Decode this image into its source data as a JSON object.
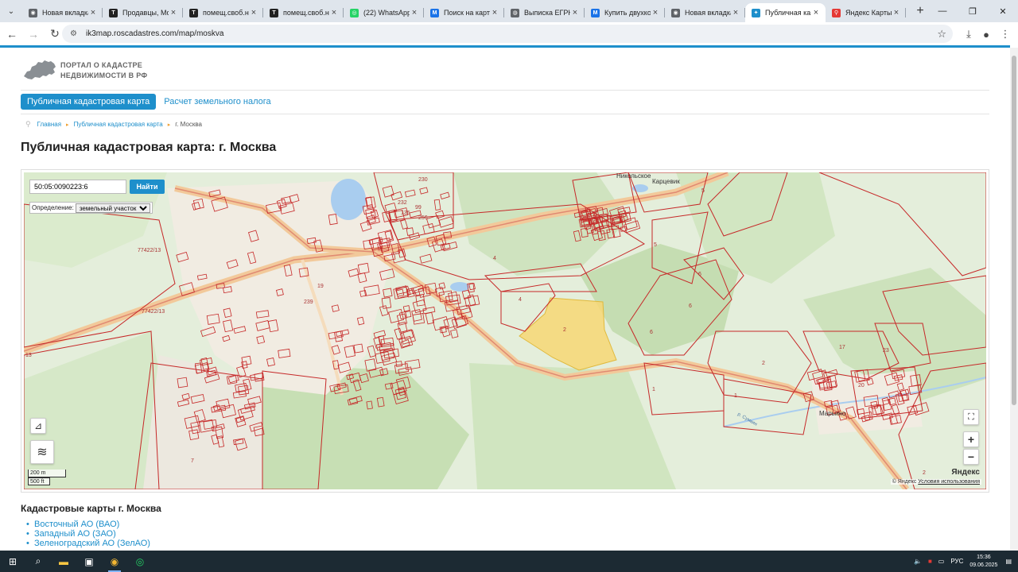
{
  "browser": {
    "tabs": [
      {
        "title": "Новая вкладка",
        "icon": "chrome-icon",
        "color": "#5f6368"
      },
      {
        "title": "Продавцы, Мо",
        "icon": "t-icon",
        "color": "#222222"
      },
      {
        "title": "помещ.своб.н",
        "icon": "t-icon",
        "color": "#222222"
      },
      {
        "title": "помещ.своб.н",
        "icon": "t-icon",
        "color": "#222222"
      },
      {
        "title": "(22) WhatsApp",
        "icon": "whatsapp-icon",
        "color": "#25d366"
      },
      {
        "title": "Поиск на карт",
        "icon": "m-icon",
        "color": "#1a73e8"
      },
      {
        "title": "Выписка ЕГРН",
        "icon": "globe-icon",
        "color": "#5f6368"
      },
      {
        "title": "Купить двухко",
        "icon": "m-icon",
        "color": "#1a73e8"
      },
      {
        "title": "Новая вкладка",
        "icon": "chrome-icon",
        "color": "#5f6368"
      },
      {
        "title": "Публичная ка",
        "icon": "ppk-icon",
        "color": "#1e8fcb",
        "active": true
      },
      {
        "title": "Яндекс Карты",
        "icon": "map-pin-icon",
        "color": "#e53935"
      }
    ],
    "url": "ik3map.roscadastres.com/map/moskva"
  },
  "site": {
    "logo_line1": "ПОРТАЛ О КАДАСТРЕ",
    "logo_line2": "НЕДВИЖИМОСТИ В РФ",
    "menu_active": "Публичная кадастровая карта",
    "menu_link": "Расчет земельного налога",
    "breadcrumbs": [
      "Главная",
      "Публичная кадастровая карта",
      "г. Москва"
    ],
    "page_title": "Публичная кадастровая карта: г. Москва"
  },
  "map": {
    "search_value": "50:05:0090223:6",
    "search_button": "Найти",
    "definition_label": "Определение:",
    "definition_value": "земельный участок",
    "scale_metric": "200 m",
    "scale_imperial": "500 ft",
    "brand": "Яндекс",
    "copyright": "© Яндекс",
    "terms_link": "Условия использования",
    "place_labels": [
      "Марьино",
      "Карцевик",
      "Никольское",
      "р. Сумкин"
    ],
    "parcel_labels": [
      "4",
      "4",
      "2",
      "5",
      "5",
      "6",
      "6",
      "6",
      "1",
      "1",
      "2",
      "17",
      "23",
      "20",
      "7",
      "2",
      "19",
      "239",
      "77422/13",
      "77422/13",
      "13",
      "232",
      "135",
      "256",
      "230",
      "99"
    ],
    "highlight_color": "#f7d774",
    "parcel_line_color": "#c62828"
  },
  "lists": {
    "cadastral_heading": "Кадастровые карты г. Москва",
    "districts": [
      "Восточный АО (ВАО)",
      "Западный АО (ЗАО)",
      "Зеленоградский АО (ЗелАО)"
    ]
  },
  "taskbar": {
    "lang": "РУС",
    "time": "15:36",
    "date": "09.06.2025"
  }
}
